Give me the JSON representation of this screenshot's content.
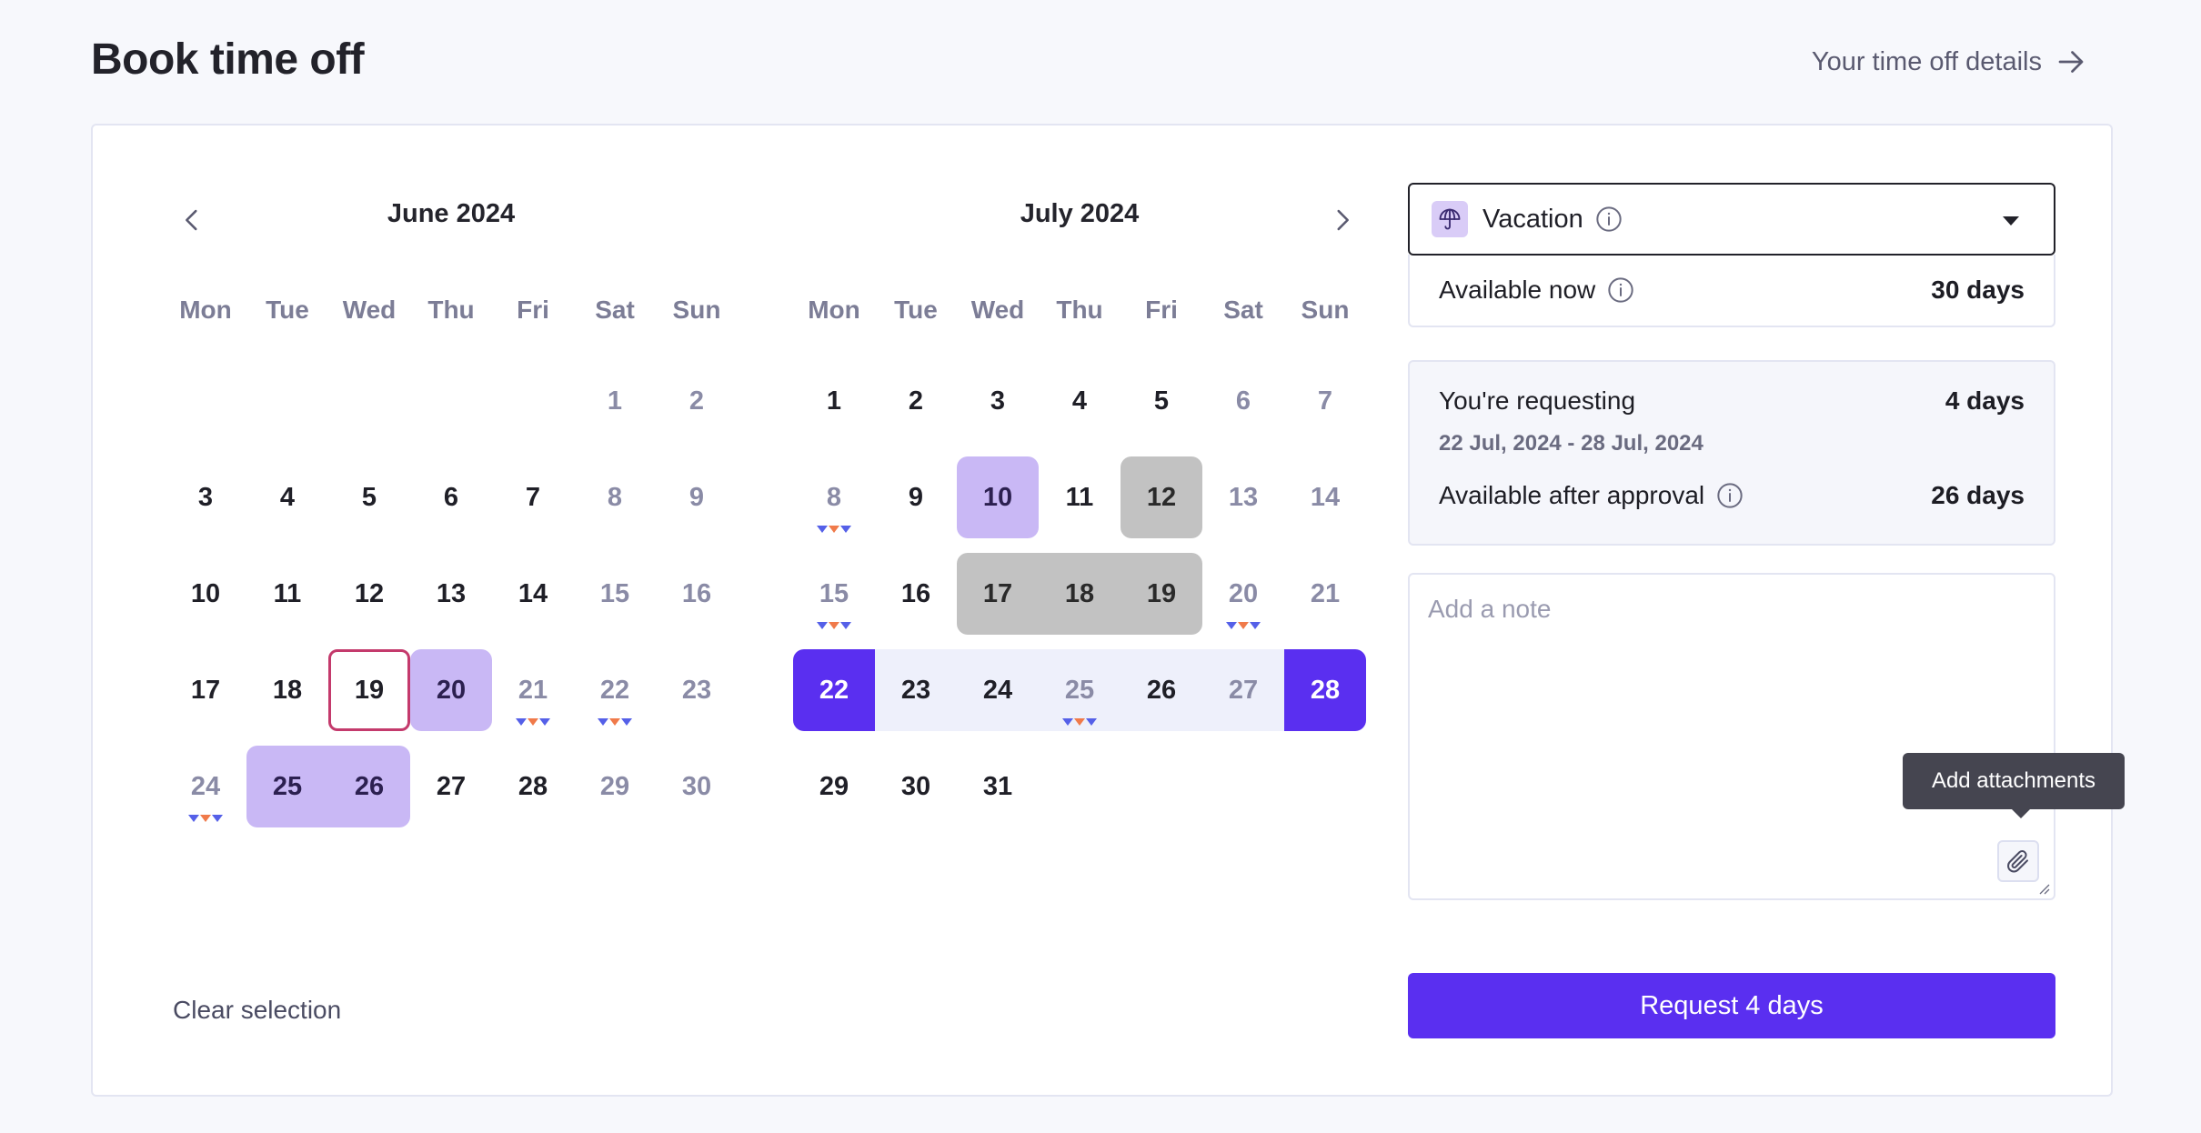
{
  "header": {
    "title": "Book time off",
    "details_link": "Your time off details"
  },
  "calendar": {
    "weekdays": [
      "Mon",
      "Tue",
      "Wed",
      "Thu",
      "Fri",
      "Sat",
      "Sun"
    ],
    "months": [
      {
        "title": "June 2024",
        "days": [
          {
            "n": ""
          },
          {
            "n": ""
          },
          {
            "n": ""
          },
          {
            "n": ""
          },
          {
            "n": ""
          },
          {
            "n": "1",
            "s": "weekend"
          },
          {
            "n": "2",
            "s": "weekend"
          },
          {
            "n": "3"
          },
          {
            "n": "4"
          },
          {
            "n": "5"
          },
          {
            "n": "6"
          },
          {
            "n": "7"
          },
          {
            "n": "8",
            "s": "weekend"
          },
          {
            "n": "9",
            "s": "weekend"
          },
          {
            "n": "10"
          },
          {
            "n": "11"
          },
          {
            "n": "12"
          },
          {
            "n": "13"
          },
          {
            "n": "14"
          },
          {
            "n": "15",
            "s": "weekend"
          },
          {
            "n": "16",
            "s": "weekend"
          },
          {
            "n": "17"
          },
          {
            "n": "18"
          },
          {
            "n": "19",
            "s": "today"
          },
          {
            "n": "20",
            "s": "holiday"
          },
          {
            "n": "21",
            "s": "weekend",
            "m": "bob"
          },
          {
            "n": "22",
            "s": "weekend",
            "m": "bob"
          },
          {
            "n": "23",
            "s": "weekend"
          },
          {
            "n": "24",
            "s": "weekend",
            "m": "bob"
          },
          {
            "n": "25",
            "s": "hl rl"
          },
          {
            "n": "26",
            "s": "hl rr"
          },
          {
            "n": "27"
          },
          {
            "n": "28"
          },
          {
            "n": "29",
            "s": "weekend"
          },
          {
            "n": "30",
            "s": "weekend"
          }
        ]
      },
      {
        "title": "July 2024",
        "days": [
          {
            "n": "1"
          },
          {
            "n": "2"
          },
          {
            "n": "3"
          },
          {
            "n": "4"
          },
          {
            "n": "5"
          },
          {
            "n": "6",
            "s": "weekend"
          },
          {
            "n": "7",
            "s": "weekend"
          },
          {
            "n": "8",
            "s": "weekend",
            "m": "bob"
          },
          {
            "n": "9"
          },
          {
            "n": "10",
            "s": "holiday"
          },
          {
            "n": "11"
          },
          {
            "n": "12",
            "s": "blocked ra"
          },
          {
            "n": "13",
            "s": "weekend"
          },
          {
            "n": "14",
            "s": "weekend"
          },
          {
            "n": "15",
            "s": "weekend",
            "m": "bob"
          },
          {
            "n": "16"
          },
          {
            "n": "17",
            "s": "blocked rl"
          },
          {
            "n": "18",
            "s": "blocked"
          },
          {
            "n": "19",
            "s": "blocked rr"
          },
          {
            "n": "20",
            "s": "weekend",
            "m": "bob"
          },
          {
            "n": "21",
            "s": "weekend"
          },
          {
            "n": "22",
            "s": "range-start"
          },
          {
            "n": "23",
            "s": "in-range"
          },
          {
            "n": "24",
            "s": "in-range"
          },
          {
            "n": "25",
            "s": "in-range weekend",
            "m": "bob"
          },
          {
            "n": "26",
            "s": "in-range"
          },
          {
            "n": "27",
            "s": "in-range weekend"
          },
          {
            "n": "28",
            "s": "range-end"
          },
          {
            "n": "29"
          },
          {
            "n": "30"
          },
          {
            "n": "31"
          }
        ]
      }
    ]
  },
  "leave": {
    "type_label": "Vacation",
    "icon": "umbrella-icon",
    "available_now_label": "Available now",
    "available_now_value": "30 days",
    "requesting_label": "You're requesting",
    "requesting_value": "4 days",
    "requesting_dates": "22 Jul, 2024 - 28 Jul, 2024",
    "after_approval_label": "Available after approval",
    "after_approval_value": "26 days"
  },
  "note": {
    "placeholder": "Add a note",
    "attach_tooltip": "Add attachments"
  },
  "actions": {
    "request_label": "Request 4 days",
    "clear_label": "Clear selection"
  },
  "colors": {
    "accent": "#5a2ff0",
    "holiday": "#c9b8f5",
    "blocked": "#c2c2c2",
    "today_outline": "#c43a6c"
  }
}
